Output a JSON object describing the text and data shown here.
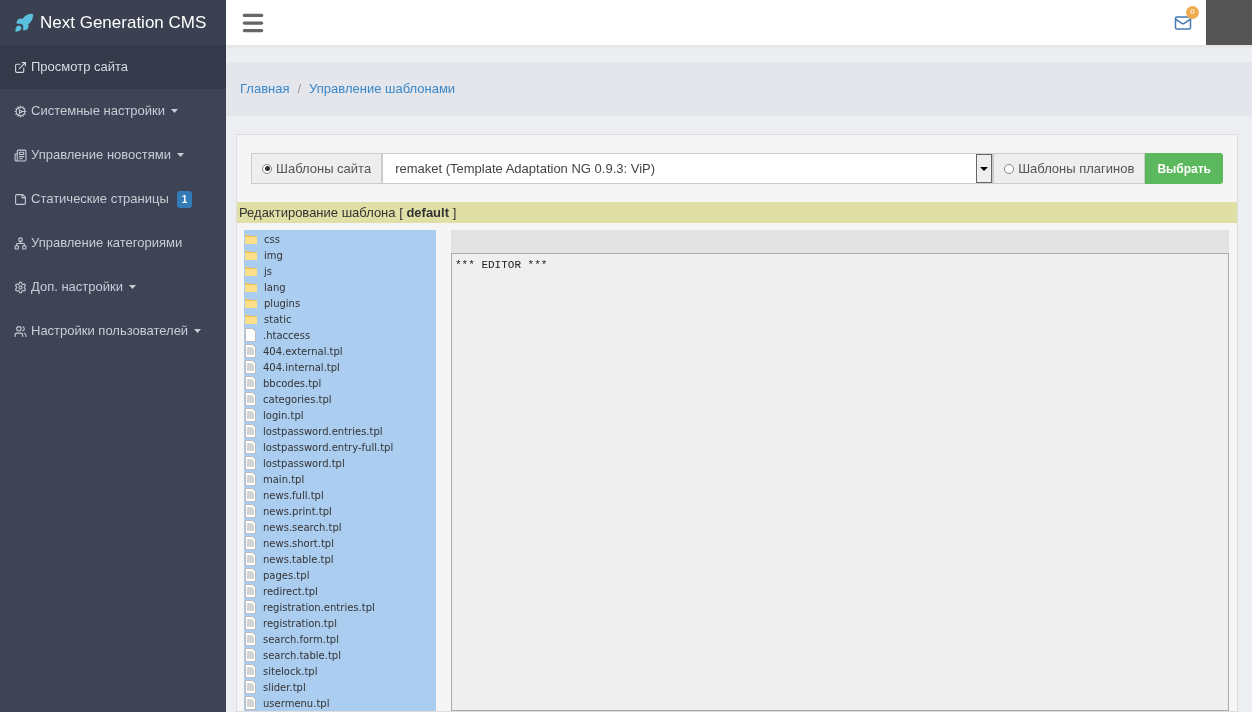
{
  "brand": {
    "title": "Next Generation CMS"
  },
  "sidebar": {
    "items": [
      {
        "label": "Просмотр сайта",
        "selected": true,
        "dropdown": false
      },
      {
        "label": "Системные настройки",
        "selected": false,
        "dropdown": true
      },
      {
        "label": "Управление новостями",
        "selected": false,
        "dropdown": true
      },
      {
        "label": "Статические страницы",
        "selected": false,
        "dropdown": false,
        "badge": "1"
      },
      {
        "label": "Управление категориями",
        "selected": false,
        "dropdown": false
      },
      {
        "label": "Доп. настройки",
        "selected": false,
        "dropdown": true
      },
      {
        "label": "Настройки пользователей",
        "selected": false,
        "dropdown": true
      }
    ]
  },
  "header": {
    "mail_badge": "0"
  },
  "breadcrumb": {
    "separator": "/",
    "items": [
      {
        "label": "Главная"
      },
      {
        "label": "Управление шаблонами"
      }
    ]
  },
  "template_selector": {
    "options": [
      {
        "label": "Шаблоны сайта",
        "selected": true
      },
      {
        "label": "Шаблоны плагинов",
        "selected": false
      }
    ],
    "select_value": "remaket (Template Adaptation NG 0.9.3: ViP)",
    "button": "Выбрать"
  },
  "editing_bar": {
    "prefix": "Редактирование шаблона [",
    "name": "default",
    "suffix": "]"
  },
  "files": [
    {
      "name": "css",
      "kind": "folder"
    },
    {
      "name": "img",
      "kind": "folder"
    },
    {
      "name": "js",
      "kind": "folder"
    },
    {
      "name": "lang",
      "kind": "folder"
    },
    {
      "name": "plugins",
      "kind": "folder"
    },
    {
      "name": "static",
      "kind": "folder"
    },
    {
      "name": ".htaccess",
      "kind": "blank"
    },
    {
      "name": "404.external.tpl",
      "kind": "file"
    },
    {
      "name": "404.internal.tpl",
      "kind": "file"
    },
    {
      "name": "bbcodes.tpl",
      "kind": "file"
    },
    {
      "name": "categories.tpl",
      "kind": "file"
    },
    {
      "name": "login.tpl",
      "kind": "file"
    },
    {
      "name": "lostpassword.entries.tpl",
      "kind": "file"
    },
    {
      "name": "lostpassword.entry-full.tpl",
      "kind": "file"
    },
    {
      "name": "lostpassword.tpl",
      "kind": "file"
    },
    {
      "name": "main.tpl",
      "kind": "file"
    },
    {
      "name": "news.full.tpl",
      "kind": "file"
    },
    {
      "name": "news.print.tpl",
      "kind": "file"
    },
    {
      "name": "news.search.tpl",
      "kind": "file"
    },
    {
      "name": "news.short.tpl",
      "kind": "file"
    },
    {
      "name": "news.table.tpl",
      "kind": "file"
    },
    {
      "name": "pages.tpl",
      "kind": "file"
    },
    {
      "name": "redirect.tpl",
      "kind": "file"
    },
    {
      "name": "registration.entries.tpl",
      "kind": "file"
    },
    {
      "name": "registration.tpl",
      "kind": "file"
    },
    {
      "name": "search.form.tpl",
      "kind": "file"
    },
    {
      "name": "search.table.tpl",
      "kind": "file"
    },
    {
      "name": "sitelock.tpl",
      "kind": "file"
    },
    {
      "name": "slider.tpl",
      "kind": "file"
    },
    {
      "name": "usermenu.tpl",
      "kind": "file"
    }
  ],
  "editor": {
    "content": "*** EDITOR ***"
  }
}
